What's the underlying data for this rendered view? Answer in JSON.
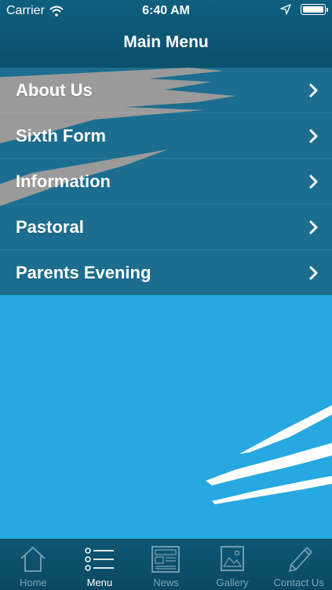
{
  "status_bar": {
    "carrier": "Carrier",
    "time": "6:40 AM"
  },
  "nav": {
    "title": "Main Menu"
  },
  "menu": {
    "items": [
      {
        "label": "About Us"
      },
      {
        "label": "Sixth Form"
      },
      {
        "label": "Information"
      },
      {
        "label": "Pastoral"
      },
      {
        "label": "Parents Evening"
      }
    ]
  },
  "tabbar": {
    "active": "Menu",
    "tabs": [
      {
        "label": "Home",
        "icon": "home-icon"
      },
      {
        "label": "Menu",
        "icon": "list-icon"
      },
      {
        "label": "News",
        "icon": "newspaper-icon"
      },
      {
        "label": "Gallery",
        "icon": "picture-icon"
      },
      {
        "label": "Contact Us",
        "icon": "pencil-icon"
      }
    ]
  },
  "colors": {
    "background": "#27a8e0",
    "menu_bg": "#1b6e8f",
    "bar_bg": "#0b4f6b",
    "tab_inactive": "#7aa4b8"
  }
}
